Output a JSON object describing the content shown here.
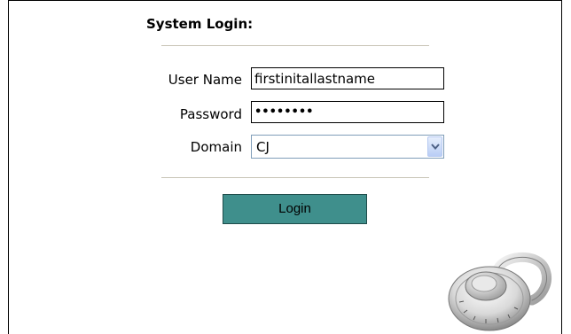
{
  "form": {
    "title": "System Login:",
    "user_label": "User Name",
    "user_value": "firstinitallastname",
    "password_label": "Password",
    "password_value": "••••••••",
    "domain_label": "Domain",
    "domain_value": "CJ",
    "login_label": "Login"
  },
  "icons": {
    "dropdown": "chevron-down-icon",
    "padlock": "combination-padlock-icon"
  },
  "colors": {
    "button_fill": "#3f8f8c",
    "divider": "#c8c4b6"
  }
}
